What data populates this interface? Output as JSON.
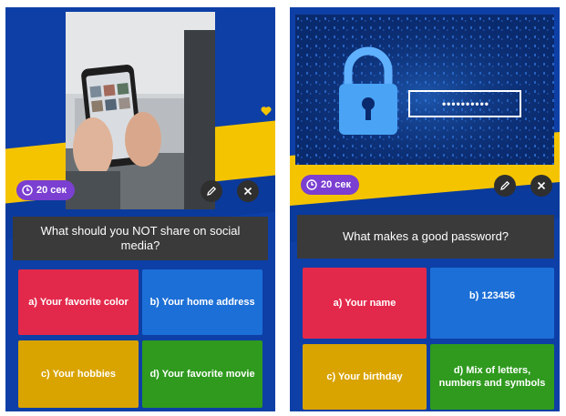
{
  "cards": [
    {
      "timer": "20 сек",
      "question": "What should you NOT share on social media?",
      "answers": [
        "a) Your favorite color",
        "b) Your home address",
        "c) Your hobbies",
        "d) Your favorite movie"
      ]
    },
    {
      "timer": "20 сек",
      "password_mask": "••••••••••",
      "question": "What makes a good password?",
      "answers": [
        "a) Your name",
        "b) 123456",
        "c) Your birthday",
        "d) Mix of letters, numbers and symbols"
      ]
    }
  ],
  "colors": {
    "background_blue": "#0d3fa6",
    "stripe_yellow": "#f5c400",
    "timer_purple": "#7b3fd1",
    "question_bg": "#3a3a3a",
    "answer_red": "#e3294b",
    "answer_blue": "#1c6fd6",
    "answer_yellow": "#d9a300",
    "answer_green": "#2f9a1e"
  },
  "icons": [
    "clock-icon",
    "pencil-icon",
    "close-icon",
    "heart-icon",
    "padlock-icon"
  ]
}
